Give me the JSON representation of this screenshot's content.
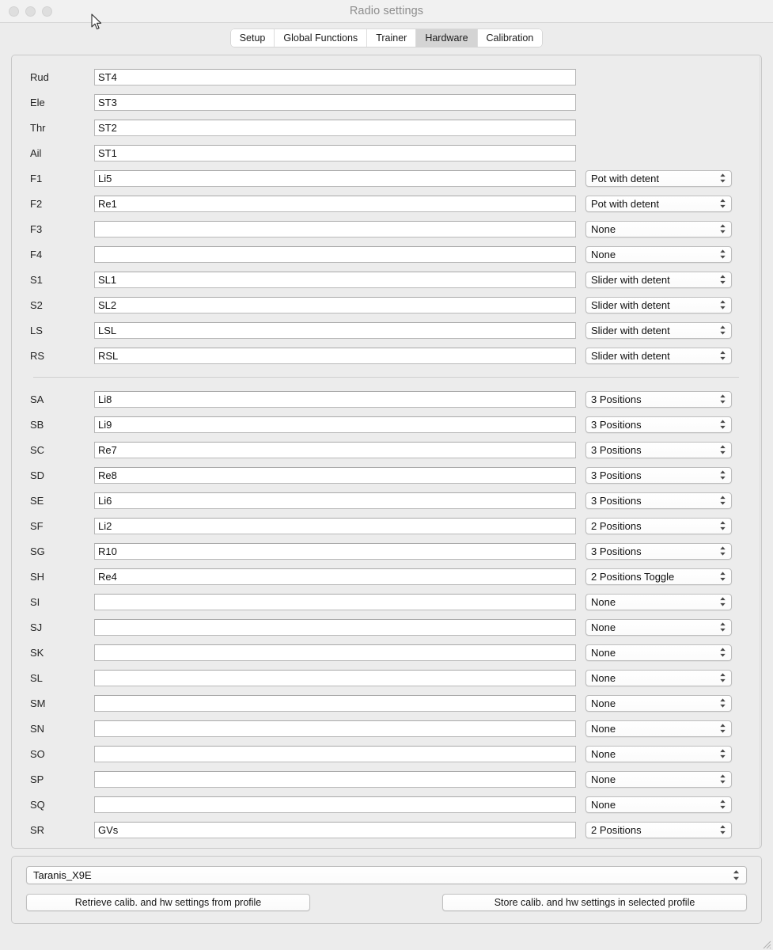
{
  "window": {
    "title": "Radio settings",
    "traffic_lights": [
      "close",
      "minimize",
      "zoom"
    ]
  },
  "tabs": [
    {
      "label": "Setup",
      "active": false
    },
    {
      "label": "Global Functions",
      "active": false
    },
    {
      "label": "Trainer",
      "active": false
    },
    {
      "label": "Hardware",
      "active": true
    },
    {
      "label": "Calibration",
      "active": false
    }
  ],
  "hardware": {
    "sticks_and_pots": [
      {
        "label": "Rud",
        "value": "ST4",
        "type": null
      },
      {
        "label": "Ele",
        "value": "ST3",
        "type": null
      },
      {
        "label": "Thr",
        "value": "ST2",
        "type": null
      },
      {
        "label": "Ail",
        "value": "ST1",
        "type": null
      },
      {
        "label": "F1",
        "value": "Li5",
        "type": "Pot with detent"
      },
      {
        "label": "F2",
        "value": "Re1",
        "type": "Pot with detent"
      },
      {
        "label": "F3",
        "value": "",
        "type": "None"
      },
      {
        "label": "F4",
        "value": "",
        "type": "None"
      },
      {
        "label": "S1",
        "value": "SL1",
        "type": "Slider with detent"
      },
      {
        "label": "S2",
        "value": "SL2",
        "type": "Slider with detent"
      },
      {
        "label": "LS",
        "value": "LSL",
        "type": "Slider with detent"
      },
      {
        "label": "RS",
        "value": "RSL",
        "type": "Slider with detent"
      }
    ],
    "switches": [
      {
        "label": "SA",
        "value": "Li8",
        "type": "3 Positions"
      },
      {
        "label": "SB",
        "value": "Li9",
        "type": "3 Positions"
      },
      {
        "label": "SC",
        "value": "Re7",
        "type": "3 Positions"
      },
      {
        "label": "SD",
        "value": "Re8",
        "type": "3 Positions"
      },
      {
        "label": "SE",
        "value": "Li6",
        "type": "3 Positions"
      },
      {
        "label": "SF",
        "value": "Li2",
        "type": "2 Positions"
      },
      {
        "label": "SG",
        "value": "R10",
        "type": "3 Positions"
      },
      {
        "label": "SH",
        "value": "Re4",
        "type": "2 Positions Toggle"
      },
      {
        "label": "SI",
        "value": "",
        "type": "None"
      },
      {
        "label": "SJ",
        "value": "",
        "type": "None"
      },
      {
        "label": "SK",
        "value": "",
        "type": "None"
      },
      {
        "label": "SL",
        "value": "",
        "type": "None"
      },
      {
        "label": "SM",
        "value": "",
        "type": "None"
      },
      {
        "label": "SN",
        "value": "",
        "type": "None"
      },
      {
        "label": "SO",
        "value": "",
        "type": "None"
      },
      {
        "label": "SP",
        "value": "",
        "type": "None"
      },
      {
        "label": "SQ",
        "value": "",
        "type": "None"
      },
      {
        "label": "SR",
        "value": "GVs",
        "type": "2 Positions"
      }
    ]
  },
  "footer": {
    "profile": "Taranis_X9E",
    "retrieve_button": "Retrieve calib. and hw settings from profile",
    "store_button": "Store calib. and hw settings in selected profile"
  },
  "colors": {
    "window_bg": "#ececec",
    "titlebar_bg": "#f1f1f1",
    "title_text": "#8d8d8d",
    "field_bg": "#ffffff",
    "active_tab_bg": "#d4d4d4",
    "panel_border": "#c8c8c8"
  }
}
